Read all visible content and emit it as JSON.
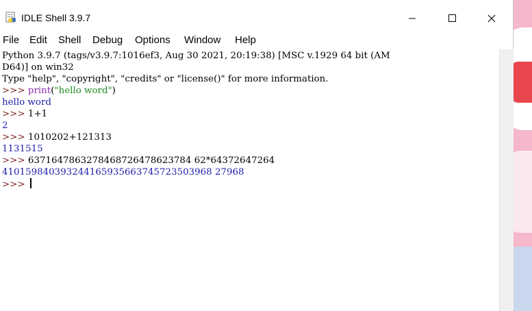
{
  "window": {
    "title": "IDLE Shell 3.9.7",
    "icon": "python-idle-icon"
  },
  "controls": {
    "minimize_icon": "minimize-icon",
    "maximize_icon": "maximize-icon",
    "close_icon": "close-icon"
  },
  "menu": {
    "items": [
      "File",
      "Edit",
      "Shell",
      "Debug",
      "Options",
      "Window",
      "Help"
    ]
  },
  "shell": {
    "banner_1": "Python 3.9.7 (tags/v3.9.7:1016ef3, Aug 30 2021, 20:19:38) [MSC v.1929 64 bit (AM",
    "banner_2": "D64)] on win32",
    "banner_3": "Type \"help\", \"copyright\", \"credits\" or \"license()\" for more information.",
    "prompt": ">>> ",
    "cmd_1_func": "print",
    "cmd_1_open": "(",
    "cmd_1_str": "\"hello word\"",
    "cmd_1_close": ")",
    "out_1": "hello word",
    "cmd_2": "1+1",
    "out_2": "2",
    "cmd_3": "1010202+121313",
    "out_3": "1131515",
    "cmd_4": "6371647863278468726478623784 62*64372647264",
    "out_4": "410159840393244165935663745723503968 27968"
  },
  "colors": {
    "prompt": "#7a1f1f",
    "stdout": "#1c1ca8",
    "builtin": "#8d2cb0",
    "string": "#1f8a1f"
  }
}
